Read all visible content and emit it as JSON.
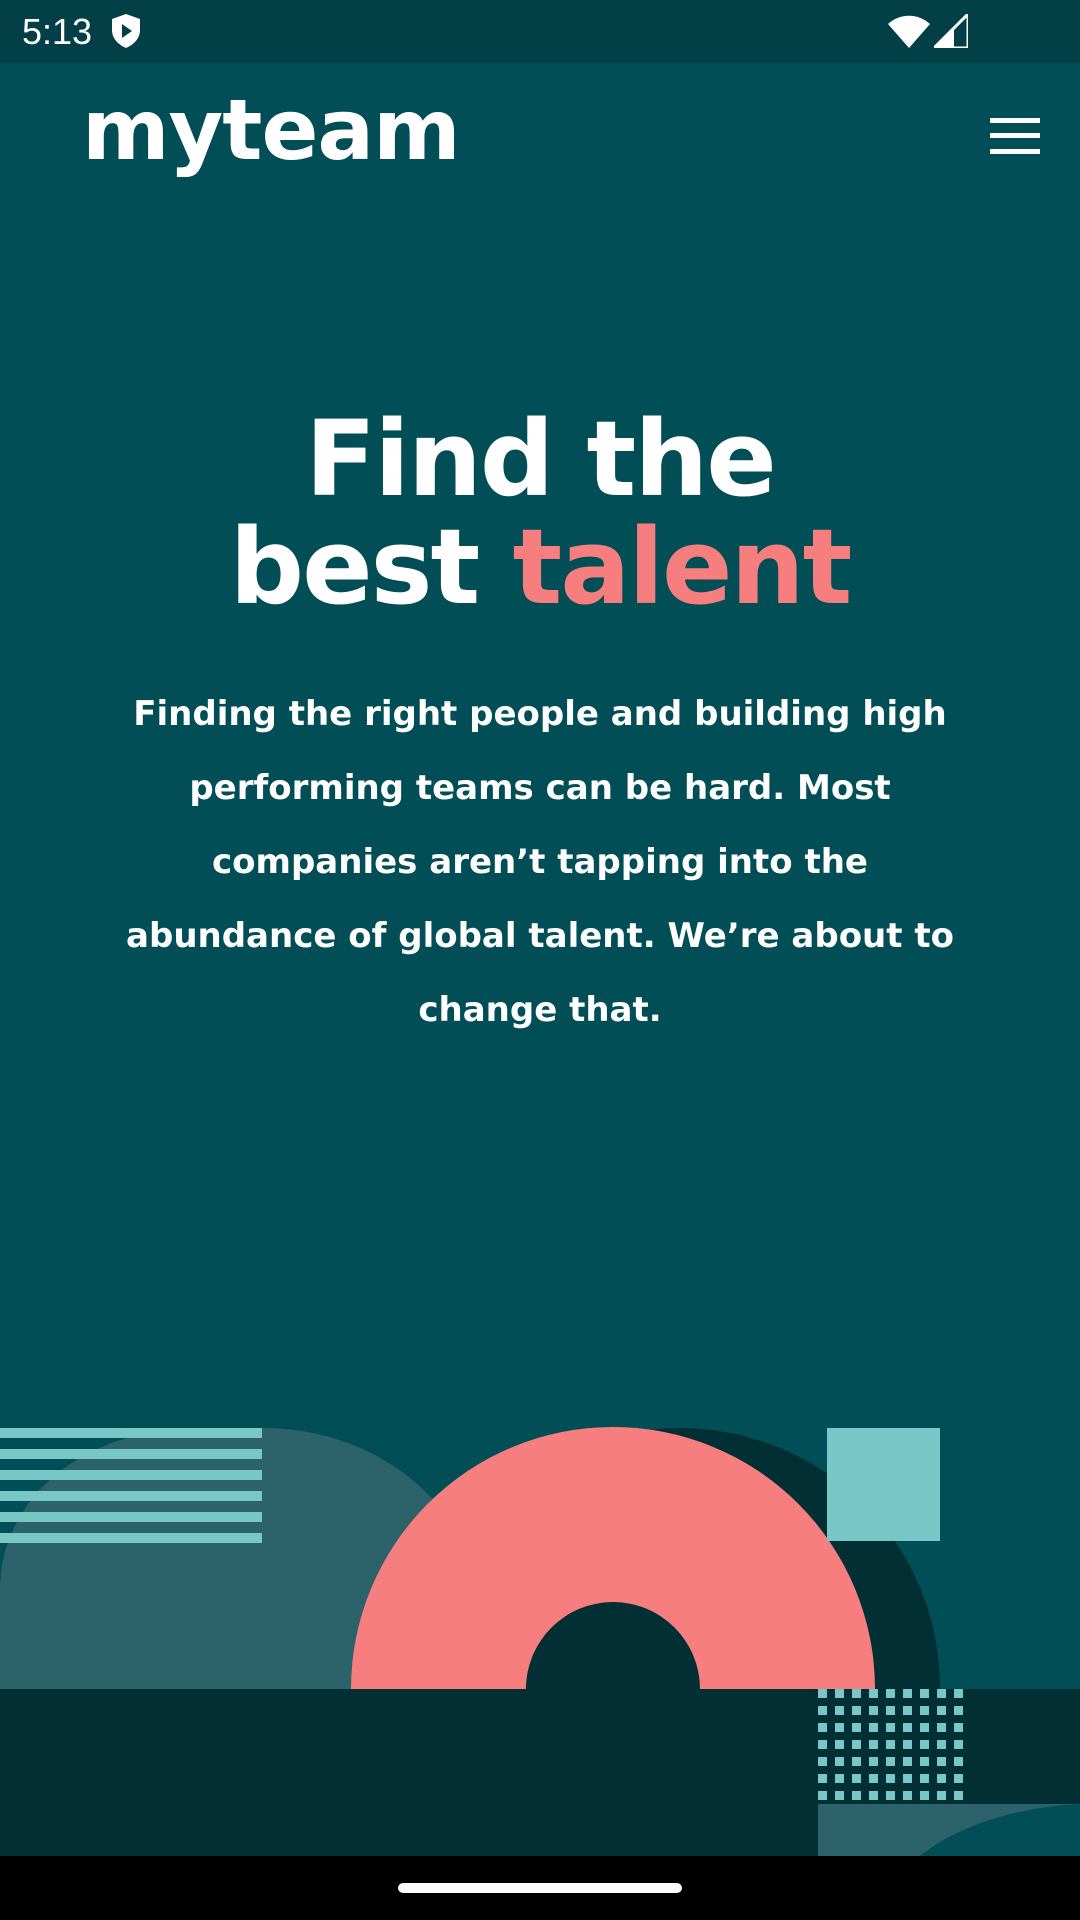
{
  "status_bar": {
    "time": "5:13"
  },
  "header": {
    "logo": "myteam",
    "menu_icon": "hamburger-menu-icon"
  },
  "hero": {
    "title_line1": "Find the",
    "title_line2_start": "best ",
    "title_accent": "talent",
    "description": "Finding the right people and building high performing teams can be hard. Most companies aren’t tapping into the abundance of global talent. We’re about to change that."
  },
  "colors": {
    "background": "#014e56",
    "accent": "#f67e7e",
    "light_teal": "#79c8c7",
    "dark_band": "#012f34",
    "muted_teal": "#2c6269"
  }
}
